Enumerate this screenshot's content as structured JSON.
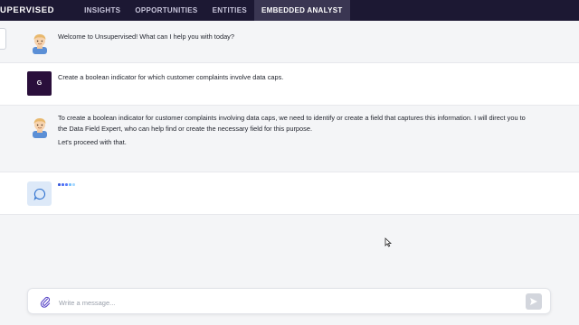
{
  "nav": {
    "brand": "UPERVISED",
    "tabs": [
      {
        "label": "INSIGHTS"
      },
      {
        "label": "OPPORTUNITIES"
      },
      {
        "label": "ENTITIES"
      },
      {
        "label": "EMBEDDED ANALYST"
      }
    ]
  },
  "messages": [
    {
      "avatar": "assistant-avatar",
      "text": "Welcome to Unsupervised! What can I help you with today?"
    },
    {
      "avatar_letter": "G",
      "text": "Create a boolean indicator for which customer complaints involve data caps."
    },
    {
      "avatar": "assistant-avatar",
      "line1": "To create a boolean indicator for customer complaints involving data caps, we need to identify or create a field that captures this information. I will direct you to the Data Field Expert, who can help find or create the necessary field for this purpose.",
      "line2": "Let's proceed with that."
    }
  ],
  "composer": {
    "placeholder": "Write a message..."
  },
  "colors": {
    "nav_bg": "#1c1833",
    "active_tab_bg": "#3a3652",
    "user_avatar_bg": "#2a0f3b",
    "typing_dots": [
      "#3b5bdb",
      "#4c6ef5",
      "#5c7cfa",
      "#74c0fc",
      "#a5d8ff"
    ]
  }
}
